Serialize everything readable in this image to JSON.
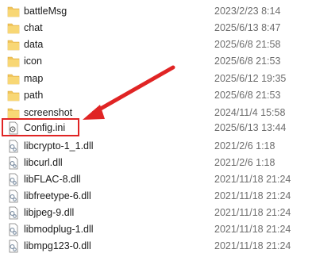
{
  "files": [
    {
      "name": "battleMsg",
      "date": "2023/2/23 8:14",
      "type": "folder-icon"
    },
    {
      "name": "chat",
      "date": "2025/6/13 8:47",
      "type": "folder-icon"
    },
    {
      "name": "data",
      "date": "2025/6/8 21:58",
      "type": "folder-icon"
    },
    {
      "name": "icon",
      "date": "2025/6/8 21:53",
      "type": "folder-icon"
    },
    {
      "name": "map",
      "date": "2025/6/12 19:35",
      "type": "folder-icon"
    },
    {
      "name": "path",
      "date": "2025/6/8 21:53",
      "type": "folder-icon"
    },
    {
      "name": "screenshot",
      "date": "2024/11/4 15:58",
      "type": "folder-icon"
    },
    {
      "name": "Config.ini",
      "date": "2025/6/13 13:44",
      "type": "ini-file-icon"
    },
    {
      "name": "libcrypto-1_1.dll",
      "date": "2021/2/6 1:18",
      "type": "dll-file-icon"
    },
    {
      "name": "libcurl.dll",
      "date": "2021/2/6 1:18",
      "type": "dll-file-icon"
    },
    {
      "name": "libFLAC-8.dll",
      "date": "2021/11/18 21:24",
      "type": "dll-file-icon"
    },
    {
      "name": "libfreetype-6.dll",
      "date": "2021/11/18 21:24",
      "type": "dll-file-icon"
    },
    {
      "name": "libjpeg-9.dll",
      "date": "2021/11/18 21:24",
      "type": "dll-file-icon"
    },
    {
      "name": "libmodplug-1.dll",
      "date": "2021/11/18 21:24",
      "type": "dll-file-icon"
    },
    {
      "name": "libmpg123-0.dll",
      "date": "2021/11/18 21:24",
      "type": "dll-file-icon"
    }
  ],
  "colors": {
    "folder": "#f2c65c",
    "highlight": "#e02424",
    "date_text": "#6d6d6d"
  }
}
